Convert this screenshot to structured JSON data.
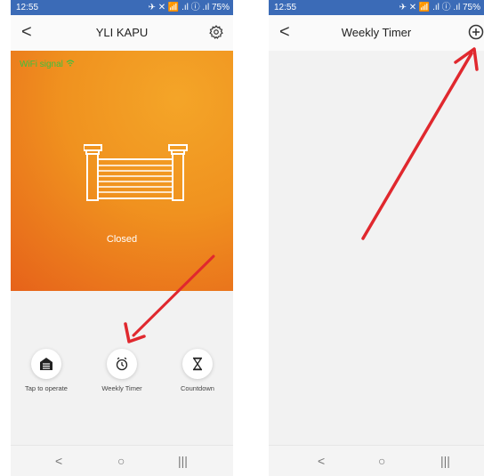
{
  "left": {
    "status": {
      "time": "12:55",
      "icons": "✈ ✕ 📶 .ıl ⓘ .ıl 75%"
    },
    "header": {
      "title": "YLI KAPU",
      "back": "<"
    },
    "hero": {
      "wifi_label": "WiFi signal",
      "state": "Closed"
    },
    "controls": [
      {
        "label": "Tap to operate",
        "icon": "garage-icon"
      },
      {
        "label": "Weekly Timer",
        "icon": "clock-icon"
      },
      {
        "label": "Countdown",
        "icon": "hourglass-icon"
      }
    ],
    "nav": {
      "back": "<",
      "home": "○",
      "recents": "|||"
    }
  },
  "right": {
    "status": {
      "time": "12:55",
      "icons": "✈ ✕ 📶 .ıl ⓘ .ıl 75%"
    },
    "header": {
      "title": "Weekly Timer",
      "back": "<",
      "add": "+"
    },
    "nav": {
      "back": "<",
      "home": "○",
      "recents": "|||"
    }
  },
  "colors": {
    "status": "#3b6bb7",
    "hero_start": "#f4a528",
    "hero_end": "#e6621a",
    "arrow": "#e0282e",
    "wifi": "#3ec13e"
  }
}
